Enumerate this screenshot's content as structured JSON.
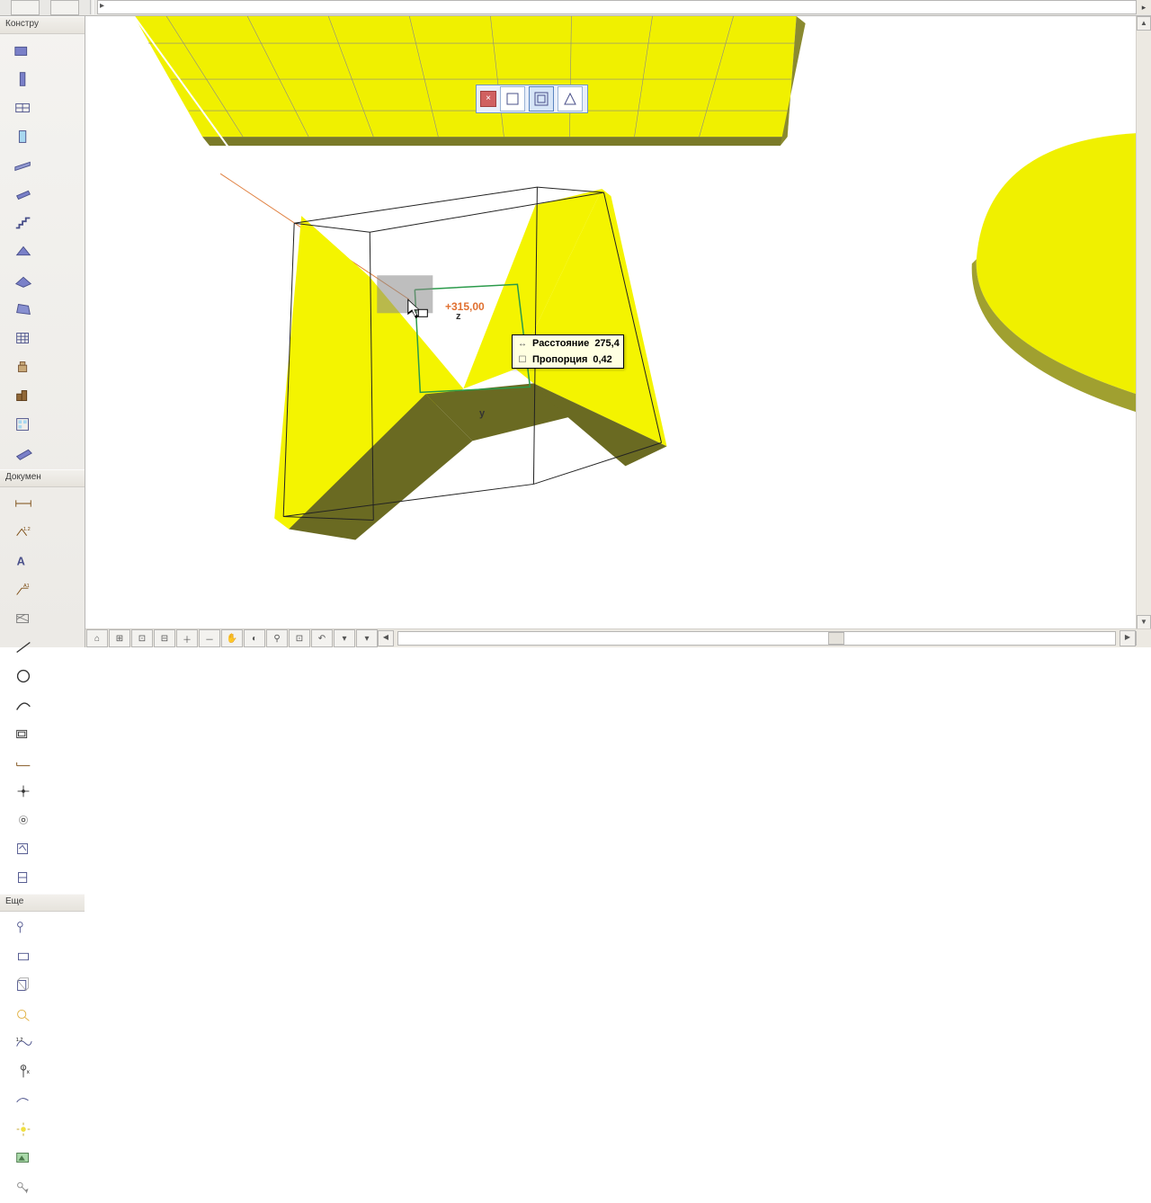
{
  "toolbar_groups": {
    "construct": "Констру",
    "document": "Докумен",
    "more": "Еще"
  },
  "dimension_label": "+315,00",
  "axis_z": "z",
  "axis_y": "y",
  "tooltip": {
    "distance_label": "Расстояние",
    "distance_value": "275,4",
    "proportion_label": "Пропорция",
    "proportion_value": "0,42"
  },
  "nav_icons": [
    "⌂",
    "⊞",
    "⊡",
    "⊟",
    "⊕",
    "⊖",
    "✋",
    "◐",
    "⚲",
    "⊡",
    "↶",
    "▾",
    "▾"
  ],
  "mini_selected": 2
}
